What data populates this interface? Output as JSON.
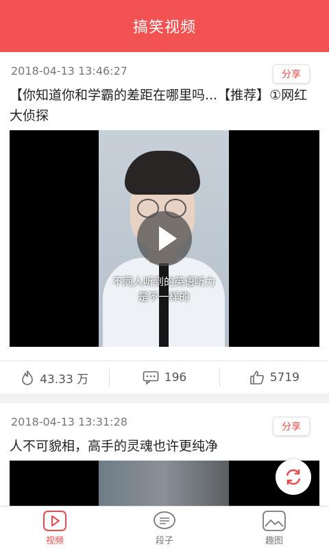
{
  "header": {
    "title": "搞笑视频"
  },
  "posts": [
    {
      "timestamp": "2018-04-13 13:46:27",
      "share_label": "分享",
      "title": "【你知道你和学霸的差距在哪里吗...【推荐】①网红大侦探",
      "caption_line1": "不同人听到的英语听力",
      "caption_line2": "是不一样的",
      "stats": {
        "views": "43.33 万",
        "comments": "196",
        "likes": "5719"
      }
    },
    {
      "timestamp": "2018-04-13 13:31:28",
      "share_label": "分享",
      "title": "人不可貌相，高手的灵魂也许更纯净"
    }
  ],
  "tabs": [
    {
      "label": "视频",
      "icon": "play-icon",
      "active": true
    },
    {
      "label": "段子",
      "icon": "chat-icon",
      "active": false
    },
    {
      "label": "趣图",
      "icon": "image-icon",
      "active": false
    }
  ],
  "colors": {
    "accent": "#f25252"
  }
}
